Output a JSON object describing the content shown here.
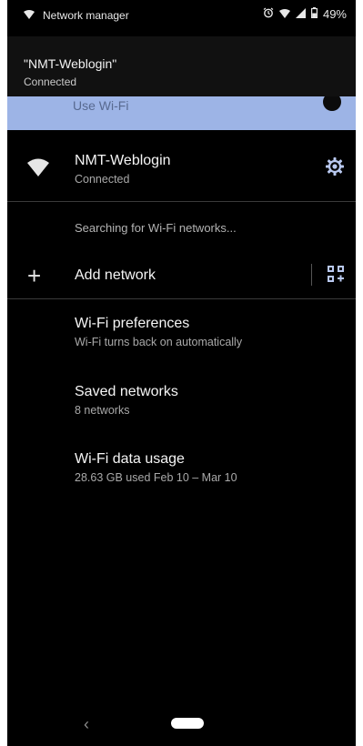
{
  "status_bar": {
    "app_label": "Network manager",
    "battery_percent": "49%"
  },
  "banner": {
    "title": "\"NMT-Weblogin\"",
    "subtitle": "Connected"
  },
  "toggle_strip": {
    "label": "Use Wi-Fi"
  },
  "current_network": {
    "name": "NMT-Weblogin",
    "status": "Connected"
  },
  "searching_text": "Searching for Wi-Fi networks...",
  "add_network": {
    "label": "Add network"
  },
  "menu": [
    {
      "title": "Wi-Fi preferences",
      "subtitle": "Wi-Fi turns back on automatically"
    },
    {
      "title": "Saved networks",
      "subtitle": "8 networks"
    },
    {
      "title": "Wi-Fi data usage",
      "subtitle": "28.63 GB used Feb 10 – Mar 10"
    }
  ],
  "colors": {
    "background": "#000000",
    "accent": "#9db4e6",
    "gear_accent": "#b9c9f0",
    "divider": "#3a3a3a"
  }
}
